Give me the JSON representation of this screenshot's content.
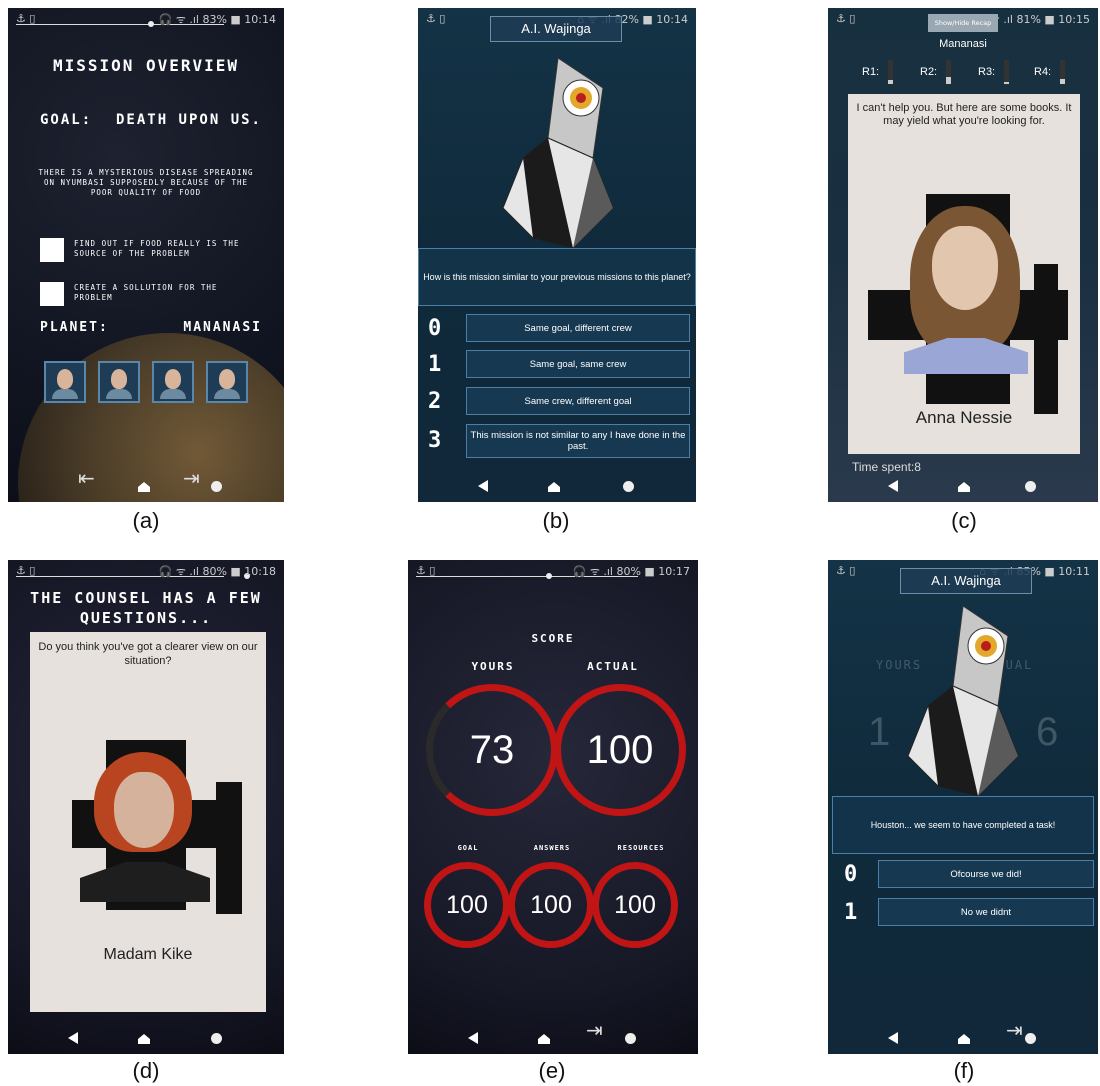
{
  "statusbars": {
    "a": "🎧 ᯤ .ıl 83% ■ 10:14",
    "b": "⌂ ᯤ .ıl 82% ■ 10:14",
    "c": "ᯤ .ıl 81% ■ 10:15",
    "d": "🎧 ᯤ .ıl 80% ■ 10:18",
    "e": "🎧 ᯤ .ıl 80% ■ 10:17",
    "f": "⌂ ᯤ .ıl 85% ■ 10:11"
  },
  "screen_a": {
    "title": "MISSION OVERVIEW",
    "goal_label": "GOAL:",
    "goal_value": "DEATH UPON US.",
    "description": "THERE IS A MYSTERIOUS DISEASE SPREADING ON NYUMBASI SUPPOSEDLY BECAUSE OF THE POOR QUALITY OF FOOD",
    "tasks": [
      "FIND OUT IF FOOD REALLY IS THE SOURCE OF THE PROBLEM",
      "CREATE A SOLLUTION FOR THE PROBLEM"
    ],
    "planet_label": "PLANET:",
    "planet_value": "MANANASI"
  },
  "screen_b": {
    "speaker": "A.I. Wajinga",
    "question": "How is this mission similar to your previous missions to this planet?",
    "answers": [
      {
        "num": "0",
        "text": "Same goal, different crew"
      },
      {
        "num": "1",
        "text": "Same goal, same crew"
      },
      {
        "num": "2",
        "text": "Same crew, different goal"
      },
      {
        "num": "3",
        "text": "This mission is not similar to any I have done in the past."
      }
    ]
  },
  "screen_c": {
    "recap_button": "Show/Hide Recap",
    "planet": "Mananasi",
    "resources": [
      "R1:",
      "R2:",
      "R3:",
      "R4:"
    ],
    "resource_levels": [
      0.15,
      0.3,
      0.1,
      0.2
    ],
    "dialog": "I can't help you. But here are some books. It may yield what you're looking for.",
    "character": "Anna Nessie",
    "time_spent": "Time spent:8"
  },
  "screen_d": {
    "title": "THE COUNSEL HAS A FEW QUESTIONS...",
    "question": "Do you think you've got a clearer view on our situation?",
    "character": "Madam Kike"
  },
  "screen_e": {
    "score_label": "SCORE",
    "yours_label": "YOURS",
    "actual_label": "ACTUAL",
    "yours": "73",
    "actual": "100",
    "goal_label": "GOAL",
    "answers_label": "ANSWERS",
    "resources_label": "RESOURCES",
    "goal": "100",
    "answers": "100",
    "resources": "100"
  },
  "screen_f": {
    "speaker": "A.I. Wajinga",
    "bg_yours": "YOURS",
    "bg_actual": "ACTUAL",
    "bg_left": "1",
    "bg_right": "6",
    "message": "Houston... we seem to have completed a task!",
    "answers": [
      {
        "num": "0",
        "text": "Ofcourse we did!"
      },
      {
        "num": "1",
        "text": "No we didnt"
      }
    ]
  },
  "captions": [
    "(a)",
    "(b)",
    "(c)",
    "(d)",
    "(e)",
    "(f)"
  ],
  "colors": {
    "ring_red": "#c11414",
    "panel_blue": "#4b7fa5",
    "card_bg": "#e6e1dc"
  }
}
